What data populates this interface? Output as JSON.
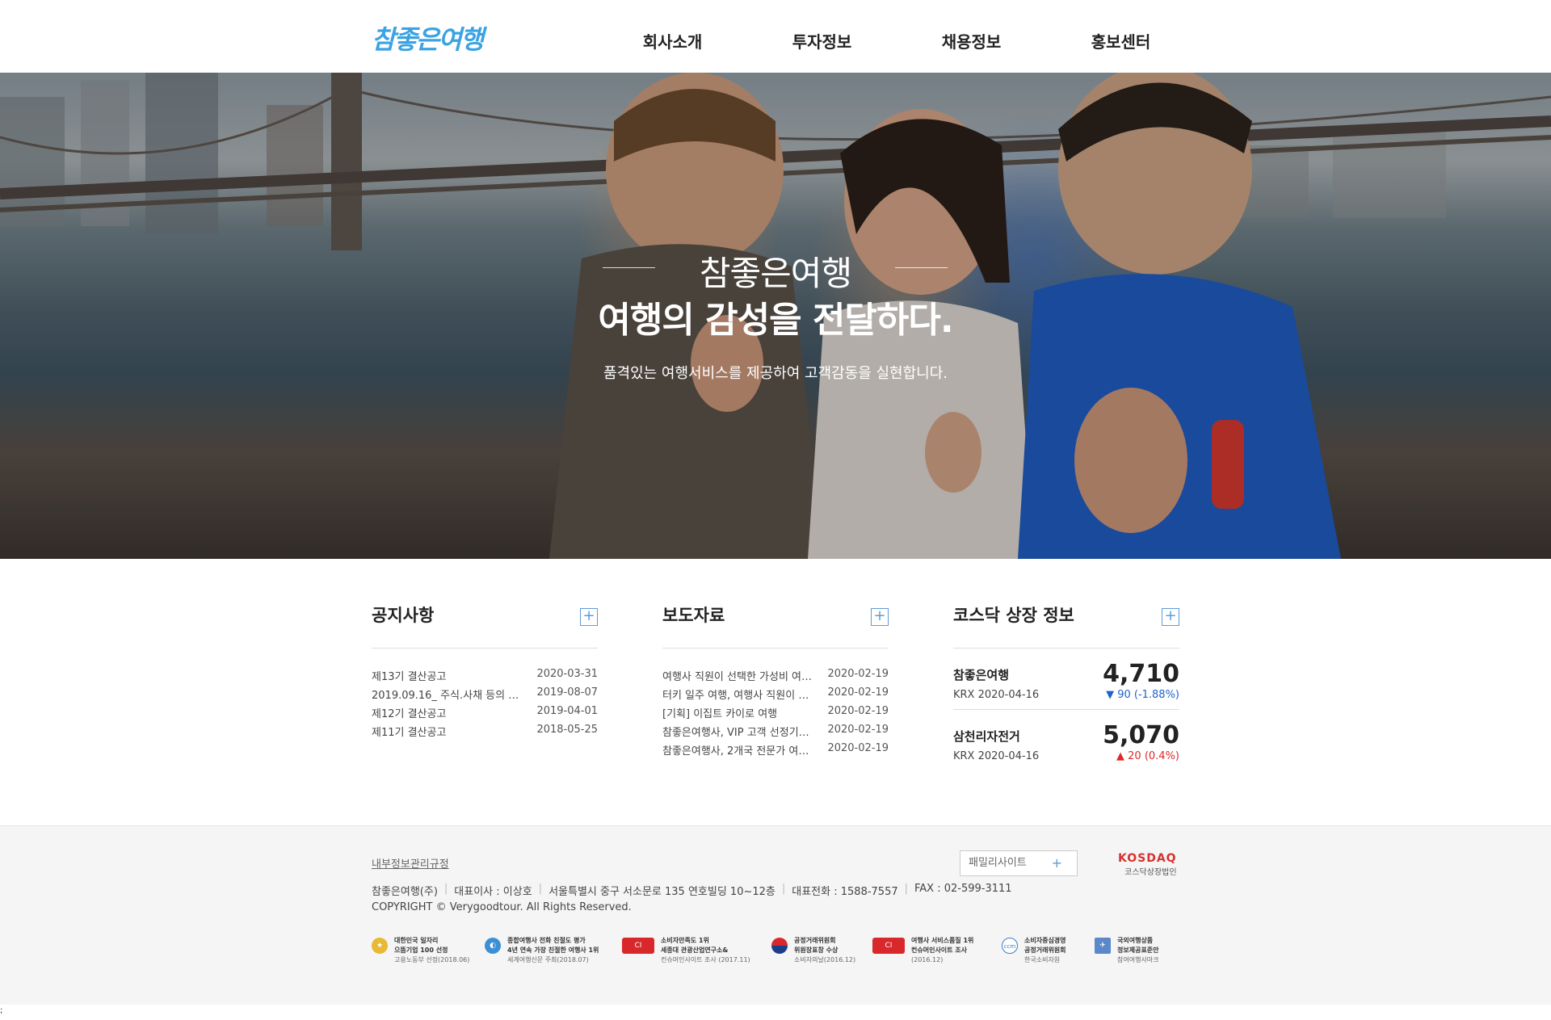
{
  "header": {
    "logo": "참좋은여행",
    "nav": [
      "회사소개",
      "투자정보",
      "채용정보",
      "홍보센터"
    ]
  },
  "hero": {
    "brand": "참좋은여행",
    "title": "여행의 감성을 전달하다.",
    "desc": "품격있는 여행서비스를 제공하여 고객감동을 실현합니다."
  },
  "notice": {
    "title": "공지사항",
    "more": "+",
    "rows": [
      {
        "title": "제13기 결산공고",
        "date": "2020-03-31"
      },
      {
        "title": "2019.09.16_ 주식.사채 등의 …",
        "date": "2019-08-07"
      },
      {
        "title": "제12기 결산공고",
        "date": "2019-04-01"
      },
      {
        "title": "제11기 결산공고",
        "date": "2018-05-25"
      }
    ]
  },
  "press": {
    "title": "보도자료",
    "more": "+",
    "rows": [
      {
        "title": "여행사 직원이 선택한 가성비 여…",
        "date": "2020-02-19"
      },
      {
        "title": "터키 일주 여행, 여행사 직원이 …",
        "date": "2020-02-19"
      },
      {
        "title": "[기획] 이집트 카이로 여행",
        "date": "2020-02-19"
      },
      {
        "title": "참좋은여행사, VIP 고객 선정기…",
        "date": "2020-02-19"
      },
      {
        "title": "참좋은여행사, 2개국 전문가 여…",
        "date": "2020-02-19"
      }
    ]
  },
  "kosdaq_info": {
    "title": "코스닥 상장 정보",
    "more": "+",
    "stocks": [
      {
        "name": "참좋은여행",
        "meta": "KRX 2020-04-16",
        "price": "4,710",
        "change": "▼ 90 (-1.88%)",
        "direction": "down"
      },
      {
        "name": "삼천리자전거",
        "meta": "KRX 2020-04-16",
        "price": "5,070",
        "change": "▲ 20 (0.4%)",
        "direction": "up"
      }
    ]
  },
  "footer": {
    "link": "내부정보관리규정",
    "family": "패밀리사이트",
    "family_plus": "+",
    "kosdaq_logo": "KOSDAQ",
    "kosdaq_sub": "코스닥상장법인",
    "info": [
      "참좋은여행(주)",
      "대표이사 : 이상호",
      "서울특별시 중구 서소문로 135 연호빌딩 10~12층",
      "대표전화 : 1588-7557",
      "FAX : 02-599-3111"
    ],
    "copyright": "COPYRIGHT © Verygoodtour. All Rights Reserved.",
    "awards": [
      {
        "icon": "award-badge-icon",
        "color": "#e8b934",
        "l1": "대한민국 일자리",
        "l2": "으뜸기업 100 선정",
        "l3": "고용노동부 선정(2018.06)"
      },
      {
        "icon": "leaf-icon",
        "color": "#3d8fd4",
        "l1": "종합여행사 전화 친절도 평가",
        "l2": "4년 연속 가장 친절한 여행사 1위",
        "l3": "세계여행신문 주최(2018.07)"
      },
      {
        "icon": "consumer-insight-icon",
        "color": "#d8282b",
        "l1": "소비자만족도 1위",
        "l2": "세종대 관광산업연구소&",
        "l3": "컨슈머인사이트 조사 (2017.11)"
      },
      {
        "icon": "taegeuk-icon",
        "color": "#1b3e8c",
        "l1": "공정거래위원회",
        "l2": "위원장표창 수상",
        "l3": "소비자의날(2016.12)"
      },
      {
        "icon": "consumer-insight-icon",
        "color": "#d8282b",
        "l1": "여행사 서비스품질 1위",
        "l2": "컨슈머인사이트 조사",
        "l3": "(2016.12)"
      },
      {
        "icon": "ccm-icon",
        "color": "#3b7fc4",
        "l1": "소비자중심경영",
        "l2": "공정거래위원회",
        "l3": "한국소비자원"
      },
      {
        "icon": "mark-icon",
        "color": "#5a88c8",
        "l1": "국외여행상품",
        "l2": "정보제공표준안",
        "l3": "참여여행사마크"
      }
    ]
  },
  "stray_mark": ";"
}
